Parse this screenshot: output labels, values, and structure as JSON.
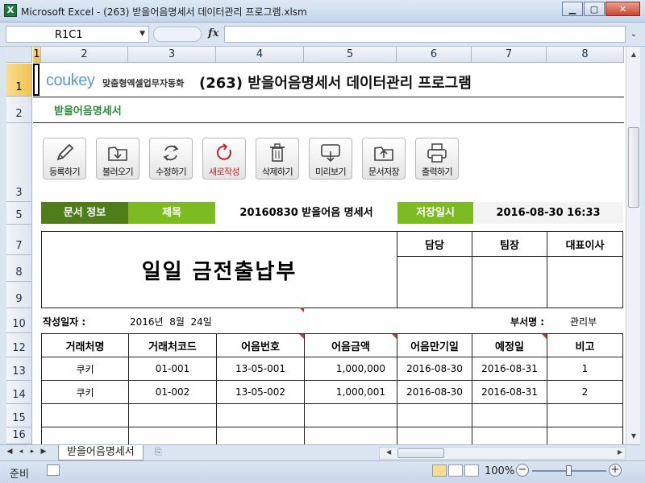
{
  "window": {
    "title": "Microsoft Excel - (263) 받을어음명세서 데이터관리 프로그램.xlsm"
  },
  "formula_bar": {
    "name_box": "R1C1",
    "fx": "fx",
    "formula": ""
  },
  "columns": [
    "1",
    "2",
    "3",
    "4",
    "5",
    "6",
    "7",
    "8"
  ],
  "rows": [
    "1",
    "2",
    "3",
    "5",
    "7",
    "8",
    "9",
    "10",
    "12",
    "13",
    "14",
    "15",
    "16"
  ],
  "sheet": {
    "logo": "coukey",
    "logo_sub": "맞춤형엑셀업무자동화",
    "title": "(263) 받을어음명세서 데이터관리 프로그램",
    "sub_title": "받을어음명세서",
    "toolbar": [
      {
        "label": "등록하기",
        "icon": "pencil-icon"
      },
      {
        "label": "불러오기",
        "icon": "load-icon"
      },
      {
        "label": "수정하기",
        "icon": "refresh-icon"
      },
      {
        "label": "새로작성",
        "icon": "new-icon"
      },
      {
        "label": "삭제하기",
        "icon": "trash-icon"
      },
      {
        "label": "미리보기",
        "icon": "preview-icon"
      },
      {
        "label": "문서저장",
        "icon": "save-icon"
      },
      {
        "label": "출력하기",
        "icon": "printer-icon"
      }
    ],
    "info": {
      "doc_info_label": "문서 정보",
      "subject_label": "제목",
      "subject_value": "20160830 받을어음 명세서",
      "saved_label": "저장일시",
      "saved_value": "2016-08-30 16:33"
    },
    "ledger": {
      "heading": "일일 금전출납부",
      "approvals": [
        "담당",
        "팀장",
        "대표이사"
      ]
    },
    "meta": {
      "date_label": "작성일자 :",
      "date_value": "2016년  8월  24일",
      "dept_label": "부서명 :",
      "dept_value": "관리부"
    },
    "table": {
      "headers": [
        "거래처명",
        "거래처코드",
        "어음번호",
        "어음금액",
        "어음만기일",
        "예정일",
        "비고"
      ],
      "rows": [
        [
          "쿠키",
          "01-001",
          "13-05-001",
          "1,000,000",
          "2016-08-30",
          "2016-08-31",
          "1"
        ],
        [
          "쿠키",
          "01-002",
          "13-05-002",
          "1,000,001",
          "2016-08-30",
          "2016-08-31",
          "2"
        ]
      ]
    }
  },
  "sheet_tab": "받을어음명세서",
  "status": {
    "ready": "준비",
    "zoom": "100%"
  },
  "colors": {
    "dark_green": "#4e7d1a",
    "light_green": "#7dbb22",
    "accent_red": "#c8202a"
  }
}
